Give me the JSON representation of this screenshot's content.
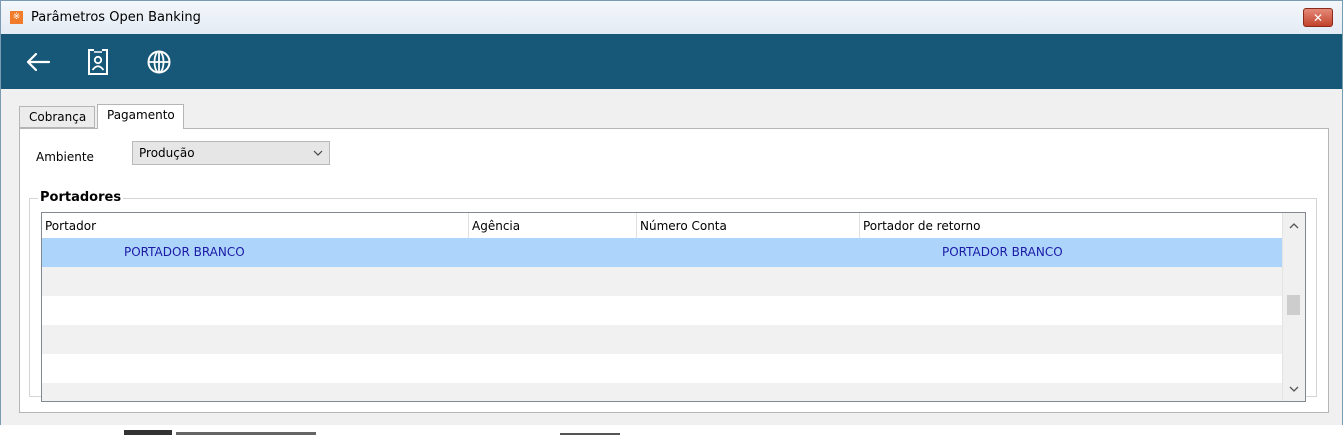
{
  "window": {
    "title": "Parâmetros Open Banking",
    "close_label": "✕",
    "app_icon_glyph": "※"
  },
  "toolbar": {
    "buttons": [
      {
        "icon": "back-arrow-icon"
      },
      {
        "icon": "id-badge-icon"
      },
      {
        "icon": "globe-icon"
      }
    ]
  },
  "tabs": [
    {
      "label": "Cobrança",
      "active": false
    },
    {
      "label": "Pagamento",
      "active": true
    }
  ],
  "form": {
    "ambiente_label": "Ambiente",
    "ambiente_value": "Produção"
  },
  "portadores": {
    "group_label": "Portadores",
    "columns": [
      "Portador",
      "Agência",
      "Número Conta",
      "Portador de retorno"
    ],
    "rows": [
      {
        "portador": "PORTADOR BRANCO",
        "agencia": "",
        "numero_conta": "",
        "portador_retorno": "PORTADOR BRANCO",
        "selected": true
      }
    ]
  },
  "colors": {
    "toolbar_bg": "#175878",
    "selected_row": "#add4fb",
    "cell_text": "#1a1aa6",
    "alt_row": "#f1f1f1"
  }
}
